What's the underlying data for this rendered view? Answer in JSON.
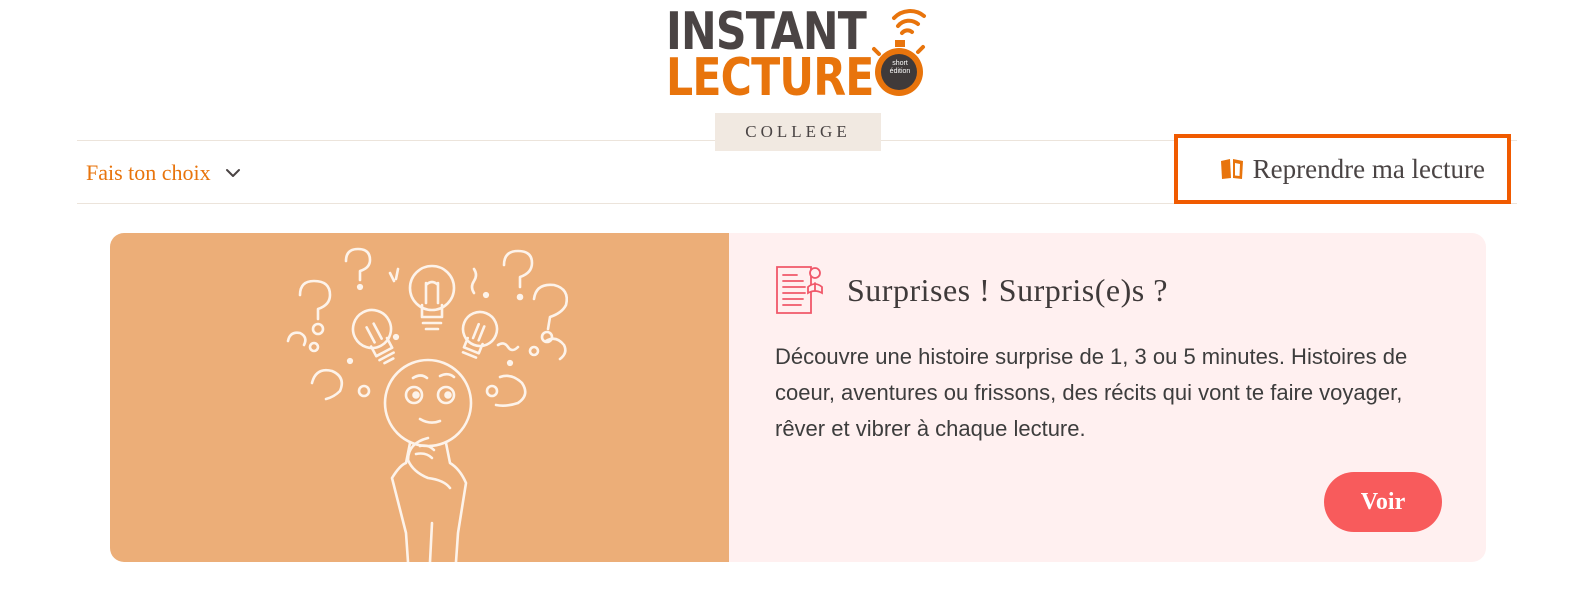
{
  "header": {
    "logo_line1": "INSTANT",
    "logo_line2": "LECTURE",
    "logo_badge": "short édition",
    "level_tab": "COLLEGE"
  },
  "nav": {
    "choice_label": "Fais ton choix",
    "choice_icon": "chevron-down-icon",
    "resume_label": "Reprendre ma lecture",
    "resume_icon": "open-book-icon"
  },
  "card": {
    "icon": "document-reader-icon",
    "title": "Surprises ! Surpris(e)s ?",
    "description": "Découvre une histoire surprise de 1, 3 ou 5 minutes. Histoires de coeur, aventures ou frissons, des récits qui vont te faire voyager, rêver et vibrer à chaque lecture.",
    "button_label": "Voir",
    "image_alt_icon": "thinking-person-lightbulbs-illustration"
  },
  "colors": {
    "brand_orange": "#e8740c",
    "highlight_border": "#f05a00",
    "card_image_bg": "#ecae78",
    "card_body_bg": "#fff0f0",
    "button_bg": "#f85b5c",
    "text_dark": "#4a4444"
  }
}
